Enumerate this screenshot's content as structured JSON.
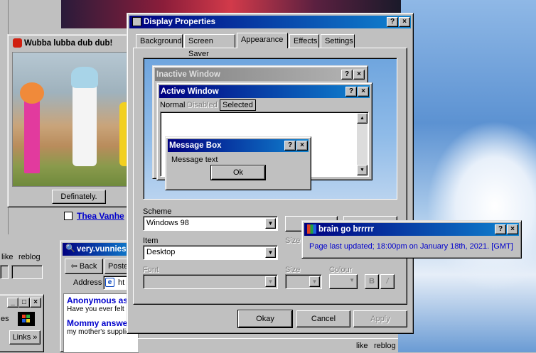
{
  "rick_window": {
    "title": "Wubba lubba dub dub!",
    "button": "Definately."
  },
  "display": {
    "title": "Display Properties",
    "tabs": [
      "Background",
      "Screen Saver",
      "Appearance",
      "Effects",
      "Settings"
    ],
    "preview": {
      "inactive_title": "Inactive Window",
      "active_title": "Active Window",
      "menu": [
        "Normal",
        "Disabled",
        "Selected"
      ],
      "message_title": "Message Box",
      "message_text": "Message text",
      "ok": "Ok"
    },
    "scheme_label": "Scheme",
    "scheme_value": "Windows 98",
    "item_label": "Item",
    "item_value": "Desktop",
    "font_label": "Font",
    "size_label": "Size",
    "colour_label": "Colour",
    "bold": "B",
    "italic": "/",
    "okay": "Okay",
    "cancel": "Cancel",
    "apply": "Apply"
  },
  "brain": {
    "title": "brain go brrrrr",
    "text": "Page last updated; 18:00pm on January 18th, 2021. [GMT]"
  },
  "bg": {
    "thea": "Thea Vanhe",
    "like": "like",
    "reblog": "reblog",
    "vunnies": "very.vunnies",
    "back": "Back",
    "posts": "Poste",
    "address": "Address",
    "addr_val": "ht",
    "ask1_title": "Anonymous ask",
    "ask1_text": "Have you ever felt",
    "ask2_title": "Mommy answer",
    "ask2_text": "my mother's supplied",
    "links": "Links",
    "es": "es",
    "like2": "like",
    "reblog2": "reblog"
  },
  "colors": {
    "accent": "#000080",
    "desktop_sky": "#4a86c8",
    "link": "#0000ff"
  }
}
